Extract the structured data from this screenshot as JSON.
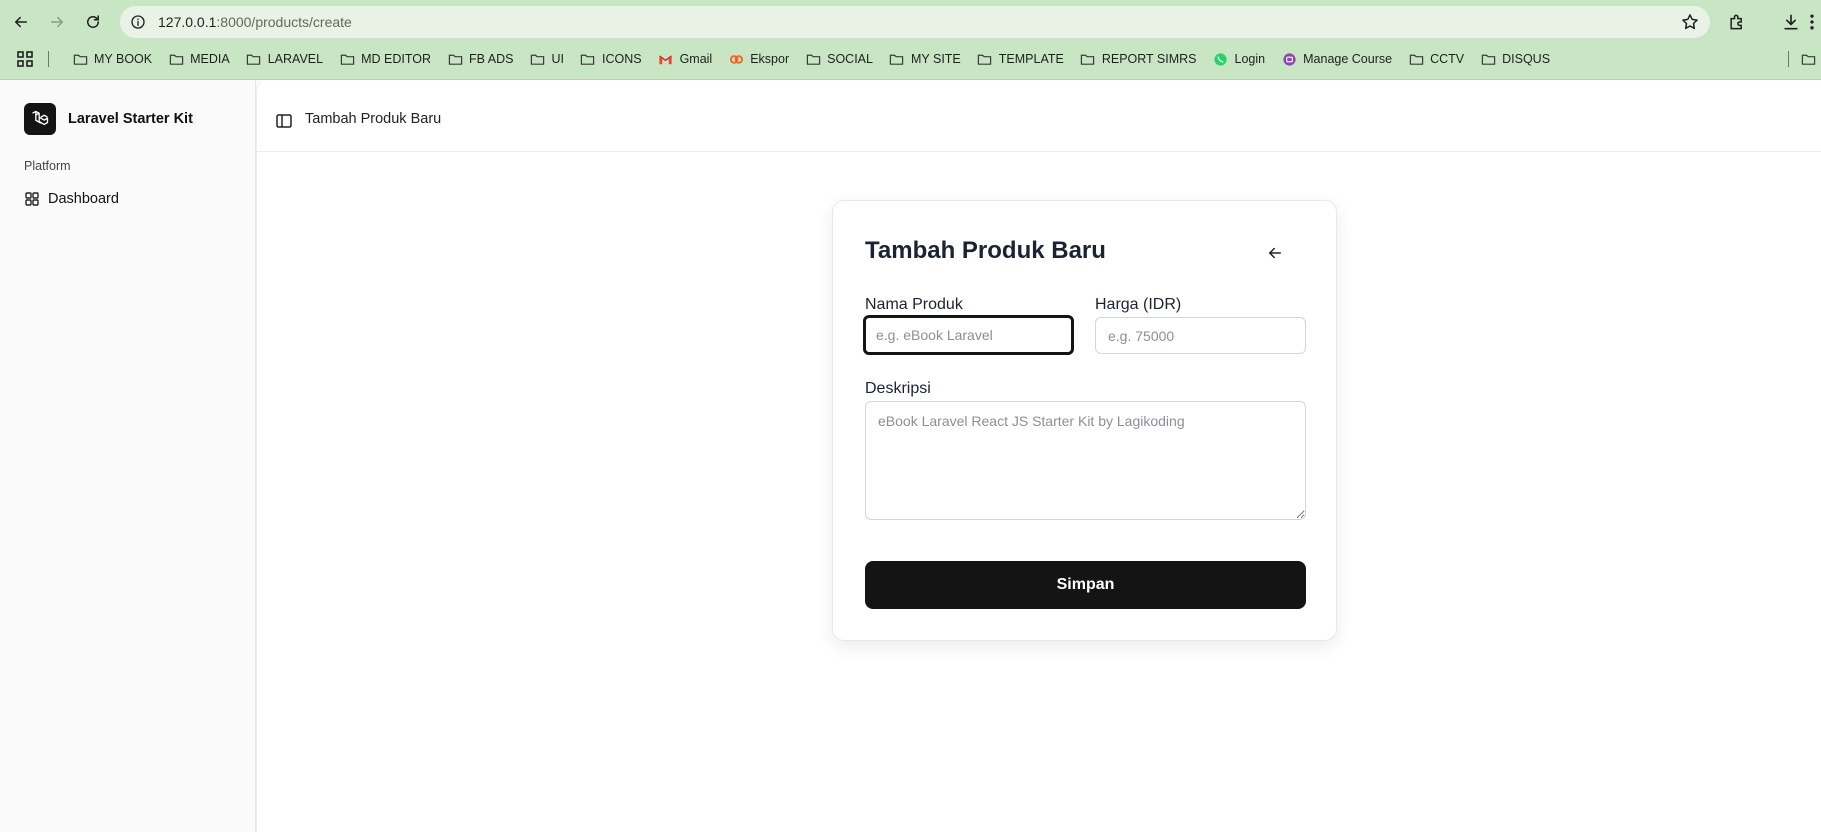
{
  "browser": {
    "url_host": "127.0.0.1",
    "url_path": ":8000/products/create",
    "bookmarks": [
      {
        "label": "MY BOOK",
        "icon": "folder-icon"
      },
      {
        "label": "MEDIA",
        "icon": "folder-icon"
      },
      {
        "label": "LARAVEL",
        "icon": "folder-icon"
      },
      {
        "label": "MD EDITOR",
        "icon": "folder-icon"
      },
      {
        "label": "FB ADS",
        "icon": "folder-icon"
      },
      {
        "label": "UI",
        "icon": "folder-icon"
      },
      {
        "label": "ICONS",
        "icon": "folder-icon"
      },
      {
        "label": "Gmail",
        "icon": "gmail-icon"
      },
      {
        "label": "Ekspor",
        "icon": "ekspor-icon"
      },
      {
        "label": "SOCIAL",
        "icon": "folder-icon"
      },
      {
        "label": "MY SITE",
        "icon": "folder-icon"
      },
      {
        "label": "TEMPLATE",
        "icon": "folder-icon"
      },
      {
        "label": "REPORT SIMRS",
        "icon": "folder-icon"
      },
      {
        "label": "Login",
        "icon": "whatsapp-icon"
      },
      {
        "label": "Manage Course",
        "icon": "course-icon"
      },
      {
        "label": "CCTV",
        "icon": "folder-icon"
      },
      {
        "label": "DISQUS",
        "icon": "folder-icon"
      }
    ]
  },
  "sidebar": {
    "brand": "Laravel Starter Kit",
    "group_label": "Platform",
    "items": [
      {
        "label": "Dashboard",
        "icon": "grid-icon"
      }
    ]
  },
  "header": {
    "breadcrumb": "Tambah Produk Baru"
  },
  "form": {
    "title": "Tambah Produk Baru",
    "name_label": "Nama Produk",
    "name_placeholder": "e.g. eBook Laravel",
    "name_value": "",
    "price_label": "Harga (IDR)",
    "price_placeholder": "e.g. 75000",
    "price_value": "",
    "description_label": "Deskripsi",
    "description_placeholder": "eBook Laravel React JS Starter Kit by Lagikoding",
    "description_value": "",
    "submit_label": "Simpan"
  },
  "colors": {
    "chrome_bg": "#c9e6c4",
    "primary_button": "#141414",
    "title_text": "#1b2333"
  }
}
